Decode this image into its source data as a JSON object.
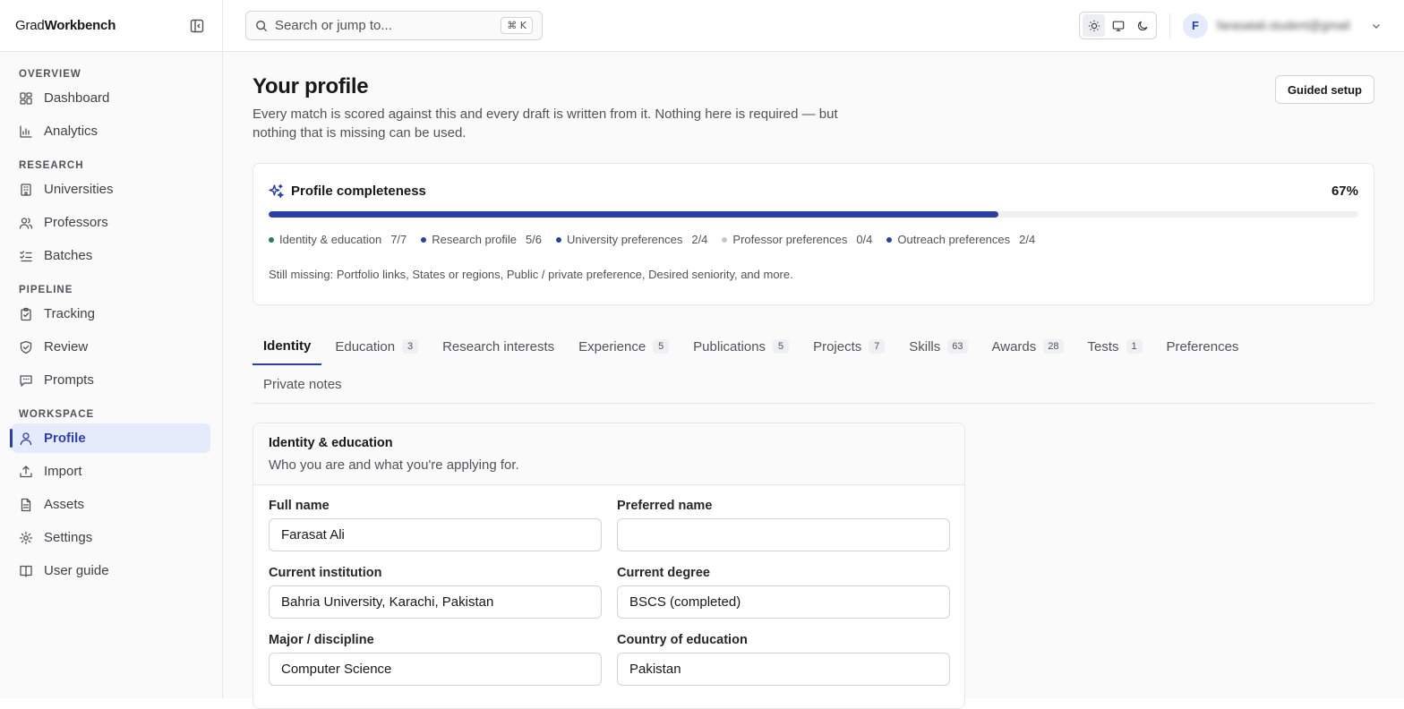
{
  "brand": {
    "prefix": "Grad",
    "suffix": "Workbench"
  },
  "sidebar": {
    "sections": [
      {
        "heading": "OVERVIEW",
        "items": [
          {
            "label": "Dashboard",
            "icon": "dashboard-icon"
          },
          {
            "label": "Analytics",
            "icon": "chart-icon"
          }
        ]
      },
      {
        "heading": "RESEARCH",
        "items": [
          {
            "label": "Universities",
            "icon": "building-icon"
          },
          {
            "label": "Professors",
            "icon": "users-icon"
          },
          {
            "label": "Batches",
            "icon": "list-check-icon"
          }
        ]
      },
      {
        "heading": "PIPELINE",
        "items": [
          {
            "label": "Tracking",
            "icon": "clipboard-icon"
          },
          {
            "label": "Review",
            "icon": "shield-check-icon"
          },
          {
            "label": "Prompts",
            "icon": "message-icon"
          }
        ]
      },
      {
        "heading": "WORKSPACE",
        "items": [
          {
            "label": "Profile",
            "icon": "user-icon",
            "active": true
          },
          {
            "label": "Import",
            "icon": "upload-icon"
          },
          {
            "label": "Assets",
            "icon": "file-icon"
          },
          {
            "label": "Settings",
            "icon": "gear-icon"
          },
          {
            "label": "User guide",
            "icon": "book-icon"
          }
        ]
      }
    ]
  },
  "search": {
    "placeholder": "Search or jump to...",
    "shortcut": "⌘ K"
  },
  "user": {
    "initial": "F",
    "email": "farasatali.student@gmail.com"
  },
  "page": {
    "title": "Your profile",
    "subtitle": "Every match is scored against this and every draft is written from it. Nothing here is required — but nothing that is missing can be used.",
    "guided_button": "Guided setup"
  },
  "completeness": {
    "title": "Profile completeness",
    "percent_label": "67%",
    "percent": 67,
    "segments": [
      {
        "label": "Identity & education",
        "value": "7/7",
        "color": "#2f7d4f"
      },
      {
        "label": "Research profile",
        "value": "5/6",
        "color": "#2c3fa8"
      },
      {
        "label": "University preferences",
        "value": "2/4",
        "color": "#2c3fa8"
      },
      {
        "label": "Professor preferences",
        "value": "0/4",
        "color": "#c4c7cf"
      },
      {
        "label": "Outreach preferences",
        "value": "2/4",
        "color": "#2c3fa8"
      }
    ],
    "missing": "Still missing: Portfolio links, States or regions, Public / private preference, Desired seniority, and more."
  },
  "tabs": [
    {
      "label": "Identity",
      "count": "",
      "active": true
    },
    {
      "label": "Education",
      "count": "3"
    },
    {
      "label": "Research interests",
      "count": ""
    },
    {
      "label": "Experience",
      "count": "5"
    },
    {
      "label": "Publications",
      "count": "5"
    },
    {
      "label": "Projects",
      "count": "7"
    },
    {
      "label": "Skills",
      "count": "63"
    },
    {
      "label": "Awards",
      "count": "28"
    },
    {
      "label": "Tests",
      "count": "1"
    },
    {
      "label": "Preferences",
      "count": ""
    },
    {
      "label": "Private notes",
      "count": ""
    }
  ],
  "form": {
    "title": "Identity & education",
    "description": "Who you are and what you're applying for.",
    "fields": [
      {
        "label": "Full name",
        "value": "Farasat Ali"
      },
      {
        "label": "Preferred name",
        "value": ""
      },
      {
        "label": "Current institution",
        "value": "Bahria University, Karachi, Pakistan"
      },
      {
        "label": "Current degree",
        "value": "BSCS (completed)"
      },
      {
        "label": "Major / discipline",
        "value": "Computer Science"
      },
      {
        "label": "Country of education",
        "value": "Pakistan"
      }
    ]
  }
}
